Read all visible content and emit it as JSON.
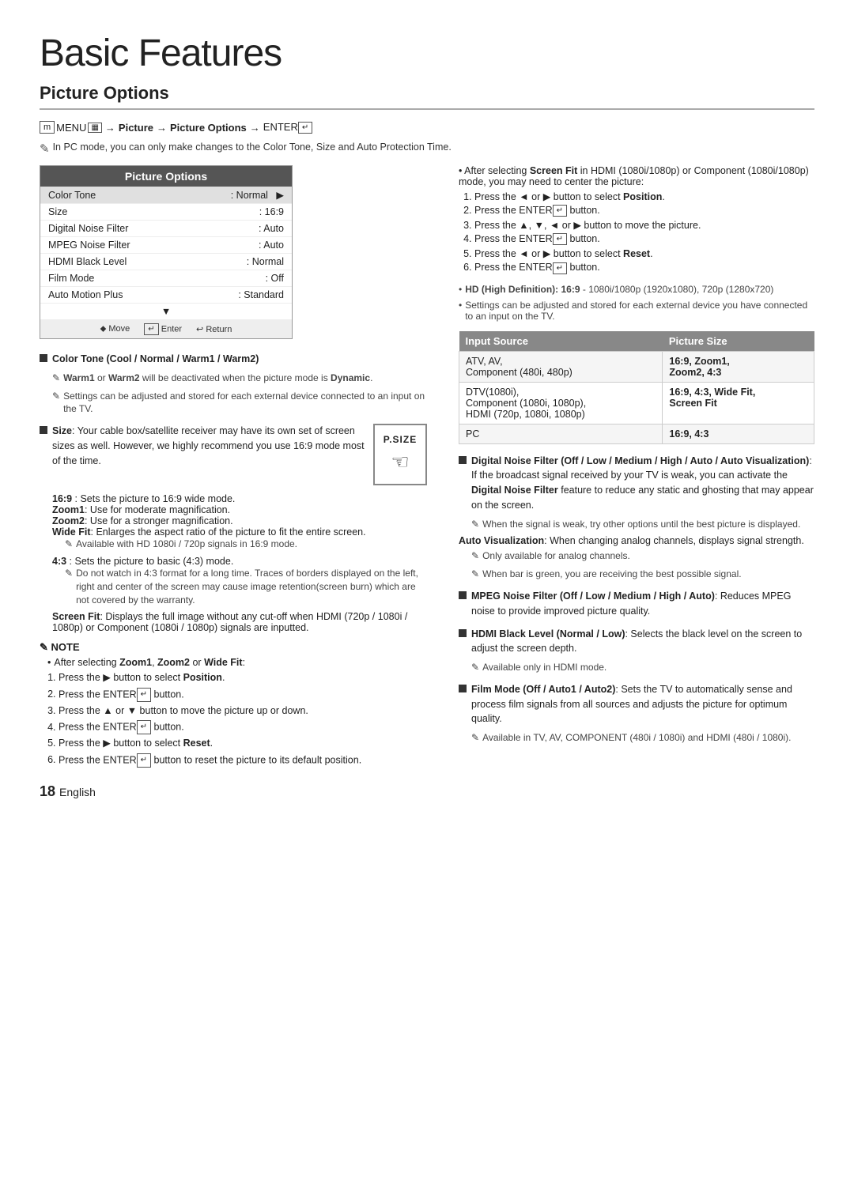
{
  "page": {
    "title": "Basic Features",
    "section": "Picture Options",
    "page_number": "18",
    "language": "English"
  },
  "menu_path": {
    "icon": "m",
    "text": "MENU",
    "arrow1": "→",
    "picture": "Picture",
    "arrow2": "→",
    "options": "Picture Options",
    "arrow3": "→",
    "enter": "ENTER"
  },
  "pc_note": "In PC mode, you can only make changes to the Color Tone, Size and Auto Protection Time.",
  "picture_options_table": {
    "header": "Picture Options",
    "rows": [
      {
        "label": "Color Tone",
        "value": "Normal",
        "selected": true,
        "arrow": true
      },
      {
        "label": "Size",
        "value": "16:9",
        "selected": false
      },
      {
        "label": "Digital Noise Filter",
        "value": "Auto",
        "selected": false
      },
      {
        "label": "MPEG Noise Filter",
        "value": "Auto",
        "selected": false
      },
      {
        "label": "HDMI Black Level",
        "value": "Normal",
        "selected": false
      },
      {
        "label": "Film Mode",
        "value": "Off",
        "selected": false
      },
      {
        "label": "Auto Motion Plus",
        "value": "Standard",
        "selected": false
      }
    ],
    "footer": {
      "move": "Move",
      "enter": "Enter",
      "return": "Return"
    }
  },
  "color_tone": {
    "header": "Color Tone (Cool / Normal / Warm1 / Warm2)",
    "note1": "Warm1 or Warm2 will be deactivated when the picture mode is Dynamic.",
    "note2": "Settings can be adjusted and stored for each external device connected to an input on the TV."
  },
  "size_section": {
    "header": "Size",
    "intro": "Size: Your cable box/satellite receiver may have its own set of screen sizes as well. However, we highly recommend you use 16:9 mode most of the time.",
    "items": [
      {
        "label": "16:9",
        "desc": ": Sets the picture to 16:9 wide mode."
      },
      {
        "label": "Zoom1",
        "desc": ": Use for moderate magnification."
      },
      {
        "label": "Zoom2",
        "desc": ": Use for a stronger magnification."
      },
      {
        "label": "Wide Fit",
        "desc": ": Enlarges the aspect ratio of the picture to fit the entire screen."
      }
    ],
    "note_hd": "Available with HD 1080i / 720p signals in 16:9 mode.",
    "item_43": {
      "label": "4:3",
      "desc": ": Sets the picture to basic (4:3) mode."
    },
    "note_43": "Do not watch in 4:3 format for a long time. Traces of borders displayed on the left, right and center of the screen may cause image retention(screen burn) which are not covered by the warranty.",
    "screen_fit_desc": "Screen Fit: Displays the full image without any cut-off when HDMI (720p / 1080i / 1080p) or Component (1080i / 1080p) signals are inputted."
  },
  "note_section": {
    "header": "NOTE",
    "intro": "After selecting Zoom1, Zoom2 or Wide Fit:",
    "steps_first": [
      "Press the ▶ button to select Position.",
      "Press the ENTER button.",
      "Press the ▲ or ▼ button to move the picture up or down.",
      "Press the ENTER button.",
      "Press the ▶ button to select Reset.",
      "Press the ENTER button to reset the picture to its default position."
    ]
  },
  "right_col": {
    "screen_fit_note": {
      "text": "After selecting Screen Fit in HDMI (1080i/1080p) or Component (1080i/1080p) mode, you may need to center the picture:",
      "steps": [
        "Press the ◄ or ▶ button to select Position.",
        "Press the ENTER button.",
        "Press the ▲, ▼, ◄ or ▶ button to move the picture.",
        "Press the ENTER button.",
        "Press the ◄ or ▶ button to select Reset.",
        "Press the ENTER button."
      ]
    },
    "hd_note": "HD (High Definition): 16:9 - 1080i/1080p (1920x1080), 720p (1280x720)",
    "settings_note": "Settings can be adjusted and stored for each external device you have connected to an input on the TV.",
    "input_table": {
      "col1": "Input Source",
      "col2": "Picture Size",
      "rows": [
        {
          "source": "ATV, AV,\nComponent (480i, 480p)",
          "size": "16:9, Zoom1,\nZoom2, 4:3"
        },
        {
          "source": "DTV(1080i),\nComponent (1080i, 1080p),\nHDMI (720p, 1080i, 1080p)",
          "size": "16:9, 4:3, Wide Fit,\nScreen Fit"
        },
        {
          "source": "PC",
          "size": "16:9, 4:3"
        }
      ]
    },
    "digital_noise": {
      "header": "Digital Noise Filter (Off / Low / Medium / High / Auto / Auto Visualization)",
      "desc": ": If the broadcast signal received by your TV is weak, you can activate the Digital Noise Filter feature to reduce any static and ghosting that may appear on the screen.",
      "note1": "When the signal is weak, try other options until the best picture is displayed.",
      "auto_vis_header": "Auto Visualization",
      "auto_vis_desc": ": When changing analog channels, displays signal strength.",
      "note2": "Only available for analog channels.",
      "note3": "When bar is green, you are receiving the best possible signal."
    },
    "mpeg_noise": {
      "header": "MPEG Noise Filter (Off / Low / Medium / High / Auto)",
      "desc": ": Reduces MPEG noise to provide improved picture quality."
    },
    "hdmi_black": {
      "header": "HDMI Black Level (Normal / Low)",
      "desc": ": Selects the black level on the screen to adjust the screen depth.",
      "note": "Available only in HDMI mode."
    },
    "film_mode": {
      "header": "Film Mode (Off / Auto1 / Auto2)",
      "desc": ": Sets the TV to automatically sense and process film signals from all sources and adjusts the picture for optimum quality.",
      "note": "Available in TV, AV, COMPONENT (480i / 1080i) and HDMI (480i / 1080i)."
    }
  }
}
